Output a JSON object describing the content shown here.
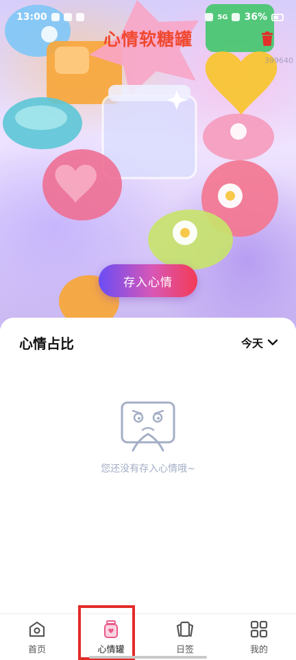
{
  "status_bar": {
    "time": "13:00",
    "network": "5G",
    "battery": "36%"
  },
  "header": {
    "title": "心情软糖罐",
    "watermark": "399640"
  },
  "hero": {
    "save_button_label": "存入心情"
  },
  "mood_card": {
    "title": "心情占比",
    "period": "今天",
    "empty_text": "您还没有存入心情哦~"
  },
  "bottom_nav": {
    "items": [
      {
        "label": "首页",
        "icon": "home-icon"
      },
      {
        "label": "心情罐",
        "icon": "jar-icon"
      },
      {
        "label": "日签",
        "icon": "cards-icon"
      },
      {
        "label": "我的",
        "icon": "grid-icon"
      }
    ],
    "active_index": 1
  },
  "colors": {
    "title": "#f0482f",
    "button_start": "#6a4df4",
    "button_end": "#f33b55",
    "highlight": "#e32b28",
    "empty_text": "#a3aec6"
  }
}
